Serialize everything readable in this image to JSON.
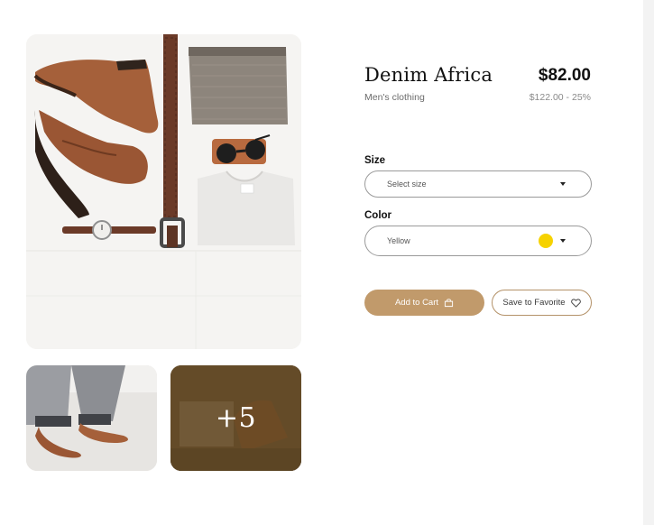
{
  "gallery": {
    "more_count": "+5"
  },
  "product": {
    "title": "Denim Africa",
    "category": "Men's clothing",
    "price": "$82.00",
    "original_price_discount": "$122.00 - 25%"
  },
  "options": {
    "size": {
      "label": "Size",
      "placeholder": "Select size"
    },
    "color": {
      "label": "Color",
      "selected": "Yellow",
      "swatch_color": "#f6d200"
    }
  },
  "actions": {
    "add_to_cart": "Add to Cart",
    "favorite": "Save to Favorite"
  },
  "icons": {
    "cart": "shopping-bag-icon",
    "favorite": "heart-icon",
    "dropdown": "caret-down-icon"
  },
  "colors": {
    "accent": "#c19a6b",
    "accent_border": "#b49269"
  }
}
